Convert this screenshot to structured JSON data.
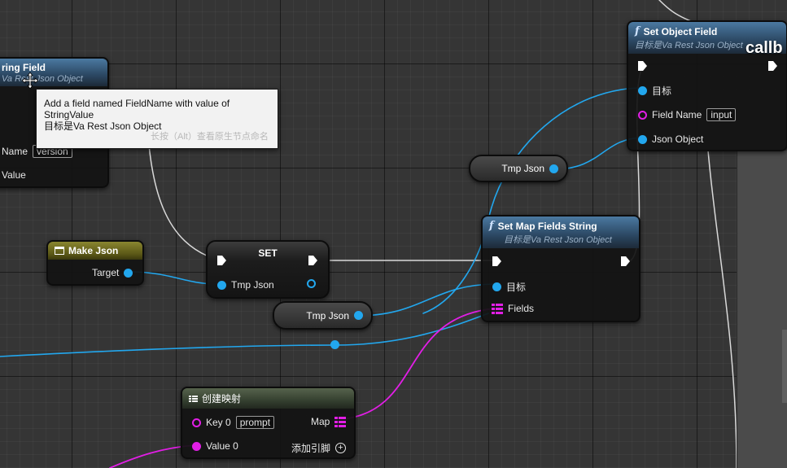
{
  "tooltip": {
    "line1": "Add a field named FieldName with value of StringValue",
    "line2": "目标是Va Rest Json Object",
    "hint": "长按（Alt）查看原生节点命名"
  },
  "comment": {
    "title": "callb"
  },
  "nodes": {
    "set_string_field": {
      "title": "ring Field",
      "subtitle": "Va Rest Json Object",
      "name_label": "Name",
      "name_value": "version",
      "value_label": "Value"
    },
    "set_object_field": {
      "title": "Set Object Field",
      "subtitle": "目标是Va Rest Json Object",
      "target_label": "目标",
      "field_name_label": "Field Name",
      "field_name_value": "input",
      "json_object_label": "Json Object"
    },
    "make_json": {
      "title": "Make Json",
      "target_label": "Target"
    },
    "set_var": {
      "title": "SET",
      "tmp_json_label": "Tmp Json"
    },
    "set_map_fields": {
      "title": "Set Map Fields String",
      "subtitle": "目标是Va Rest Json Object",
      "target_label": "目标",
      "fields_label": "Fields"
    },
    "create_map": {
      "title": "创建映射",
      "key_label": "Key 0",
      "key_value": "prompt",
      "value_label": "Value 0",
      "map_label": "Map",
      "add_pin_label": "添加引脚"
    },
    "tmp_json_get_1": {
      "label": "Tmp Json"
    },
    "tmp_json_get_2": {
      "label": "Tmp Json"
    }
  },
  "colors": {
    "exec": "#ffffff",
    "object_pin": "#22a7ee",
    "string_pin": "#e21ee6",
    "function_header": "#4b79a1",
    "make_json_header": "#6f6a1c",
    "create_map_header": "#3e4a36"
  }
}
